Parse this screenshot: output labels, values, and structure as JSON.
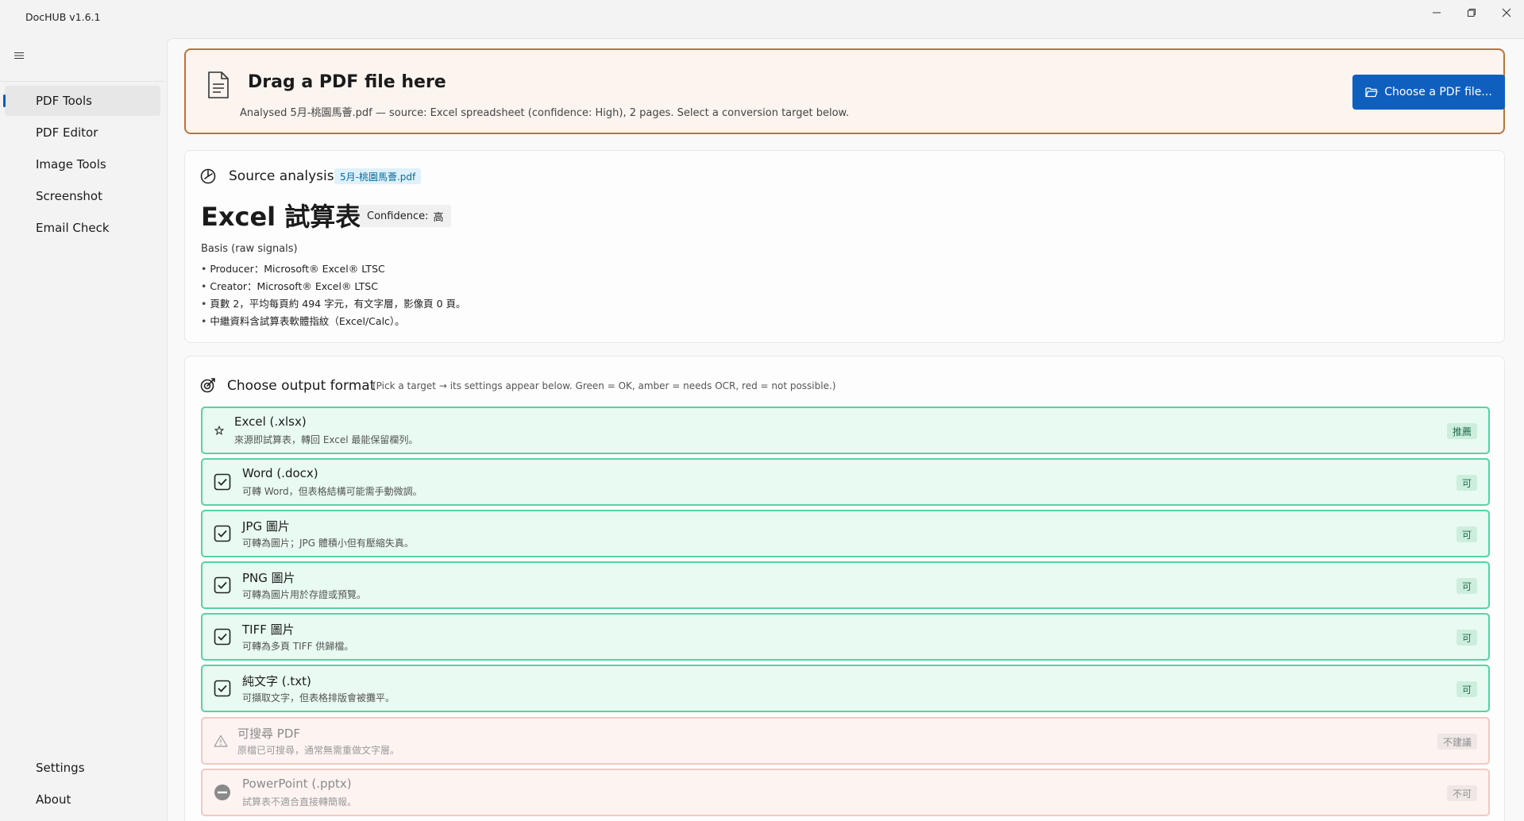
{
  "window": {
    "title": "DocHUB v1.6.1"
  },
  "sidebar": {
    "items": [
      {
        "label": "PDF Tools",
        "active": true
      },
      {
        "label": "PDF Editor"
      },
      {
        "label": "Image Tools"
      },
      {
        "label": "Screenshot"
      },
      {
        "label": "Email Check"
      }
    ],
    "footer": [
      {
        "label": "Settings"
      },
      {
        "label": "About"
      }
    ]
  },
  "drop": {
    "title": "Drag a PDF file here",
    "subtitle": "Analysed 5月-桃園馬薈.pdf — source: Excel spreadsheet (confidence: High), 2 pages. Select a conversion target below.",
    "button_label": "Choose a PDF file..."
  },
  "analysis": {
    "title": "Source analysis",
    "file_tag": "5月-桃園馬薈.pdf",
    "detected_type": "Excel 試算表",
    "confidence_label": "Confidence:",
    "confidence_value": "高",
    "basis_label": "Basis (raw signals)",
    "basis": [
      "Producer：Microsoft® Excel® LTSC",
      "Creator：Microsoft® Excel® LTSC",
      "頁數 2，平均每頁約 494 字元，有文字層，影像頁 0 頁。",
      "中繼資料含試算表軟體指紋（Excel/Calc）。"
    ]
  },
  "formats": {
    "title": "Choose output format",
    "hint": "(Pick a target → its settings appear below. Green = OK, amber = needs OCR, red = not possible.)",
    "options": [
      {
        "name": "Excel (.xlsx)",
        "desc": "來源即試算表，轉回 Excel 最能保留欄列。",
        "badge": "推薦",
        "status": "ok",
        "icon": "star-icon"
      },
      {
        "name": "Word (.docx)",
        "desc": "可轉 Word，但表格結構可能需手動微調。",
        "badge": "可",
        "status": "ok",
        "icon": "checkbox-icon"
      },
      {
        "name": "JPG 圖片",
        "desc": "可轉為圖片；JPG 體積小但有壓縮失真。",
        "badge": "可",
        "status": "ok",
        "icon": "checkbox-icon"
      },
      {
        "name": "PNG 圖片",
        "desc": "可轉為圖片用於存證或預覽。",
        "badge": "可",
        "status": "ok",
        "icon": "checkbox-icon"
      },
      {
        "name": "TIFF 圖片",
        "desc": "可轉為多頁 TIFF 供歸檔。",
        "badge": "可",
        "status": "ok",
        "icon": "checkbox-icon"
      },
      {
        "name": "純文字 (.txt)",
        "desc": "可擷取文字，但表格排版會被攤平。",
        "badge": "可",
        "status": "ok",
        "icon": "checkbox-icon"
      },
      {
        "name": "可搜尋 PDF",
        "desc": "原檔已可搜尋，通常無需重做文字層。",
        "badge": "不建議",
        "status": "warn",
        "icon": "warning-icon"
      },
      {
        "name": "PowerPoint (.pptx)",
        "desc": "試算表不適合直接轉簡報。",
        "badge": "不可",
        "status": "bad",
        "icon": "blocked-icon"
      }
    ]
  },
  "colors": {
    "accent": "#0f5fbf",
    "ok_border": "#56d3a2",
    "ok_fill": "#e8faf1",
    "bad_border": "#f2c9c2",
    "drop_border": "#b7763d"
  }
}
